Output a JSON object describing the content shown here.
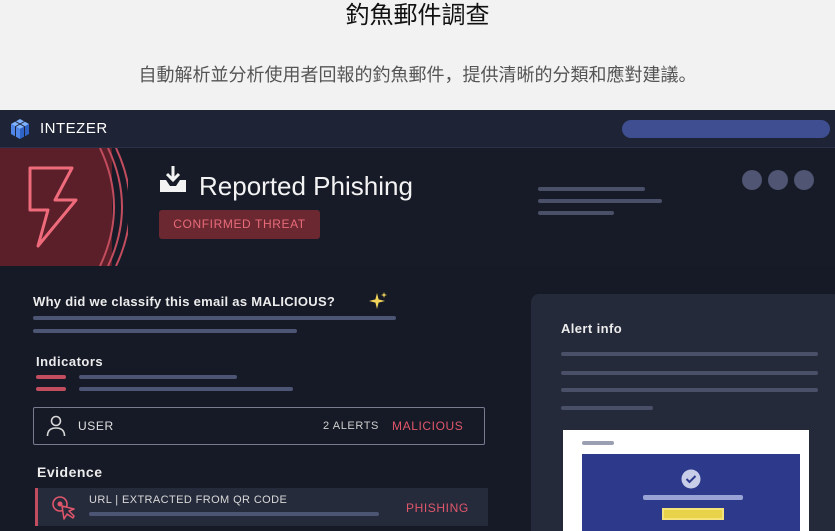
{
  "page": {
    "title": "釣魚郵件調查",
    "subtitle": "自動解析並分析使用者回報的釣魚郵件，提供清晰的分類和應對建議。"
  },
  "app": {
    "brand": "INTEZER",
    "header": {
      "title": "Reported Phishing",
      "badge": "CONFIRMED THREAT"
    },
    "classification": {
      "question": "Why did we classify this email as MALICIOUS?"
    },
    "indicators": {
      "heading": "Indicators",
      "entity": {
        "label": "USER",
        "alerts": "2 ALERTS",
        "verdict": "MALICIOUS"
      }
    },
    "evidence": {
      "heading": "Evidence",
      "item": {
        "label": "URL | EXTRACTED FROM QR CODE",
        "verdict": "PHISHING"
      }
    },
    "alert_info": {
      "title": "Alert info"
    }
  },
  "colors": {
    "app_bg": "#161a26",
    "topbar_bg": "#1e2436",
    "accent_blue": "#3e4e90",
    "threat_red": "#e0566a",
    "badge_bg": "#6b2830",
    "card_bg": "#252a3a",
    "mock_screen": "#2d3a8c",
    "mock_highlight": "#e8d24a"
  },
  "icons": [
    "cube-logo-icon",
    "lightning-icon",
    "inbox-download-icon",
    "sparkle-icon",
    "user-icon",
    "qr-pointer-icon",
    "check-circle-icon"
  ]
}
